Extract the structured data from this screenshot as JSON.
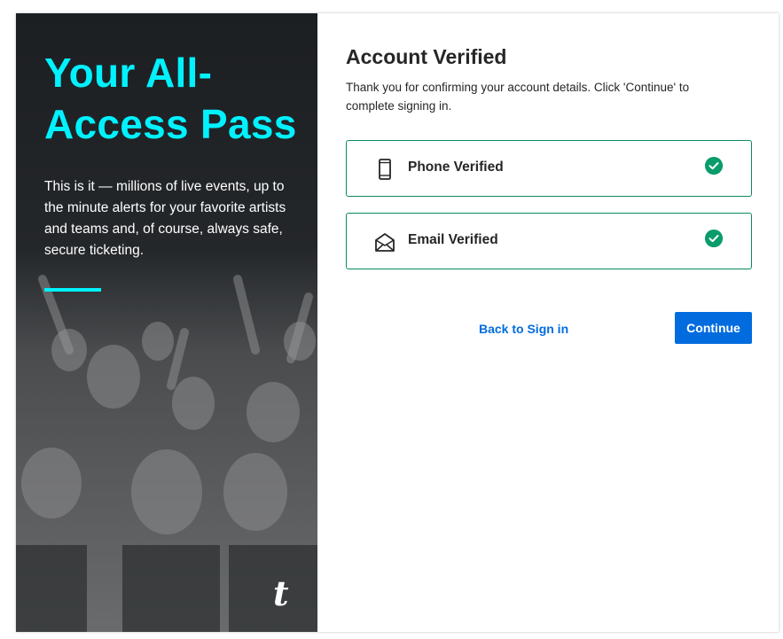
{
  "promo": {
    "title": "Your All-Access Pass",
    "description": "This is it — millions of live events, up to the minute alerts for your favorite artists and teams and, of course, always safe, secure ticketing.",
    "logo_glyph": "t",
    "accent_color": "#00f2ff"
  },
  "main": {
    "heading": "Account Verified",
    "subtext": "Thank you for confirming your account details. Click 'Continue' to complete signing in.",
    "verifications": [
      {
        "label": "Phone Verified",
        "icon": "phone-icon",
        "status": "verified"
      },
      {
        "label": "Email Verified",
        "icon": "envelope-icon",
        "status": "verified"
      }
    ],
    "back_link": "Back to Sign in",
    "continue_label": "Continue",
    "colors": {
      "primary": "#026cdf",
      "success": "#0a9c6a"
    }
  }
}
